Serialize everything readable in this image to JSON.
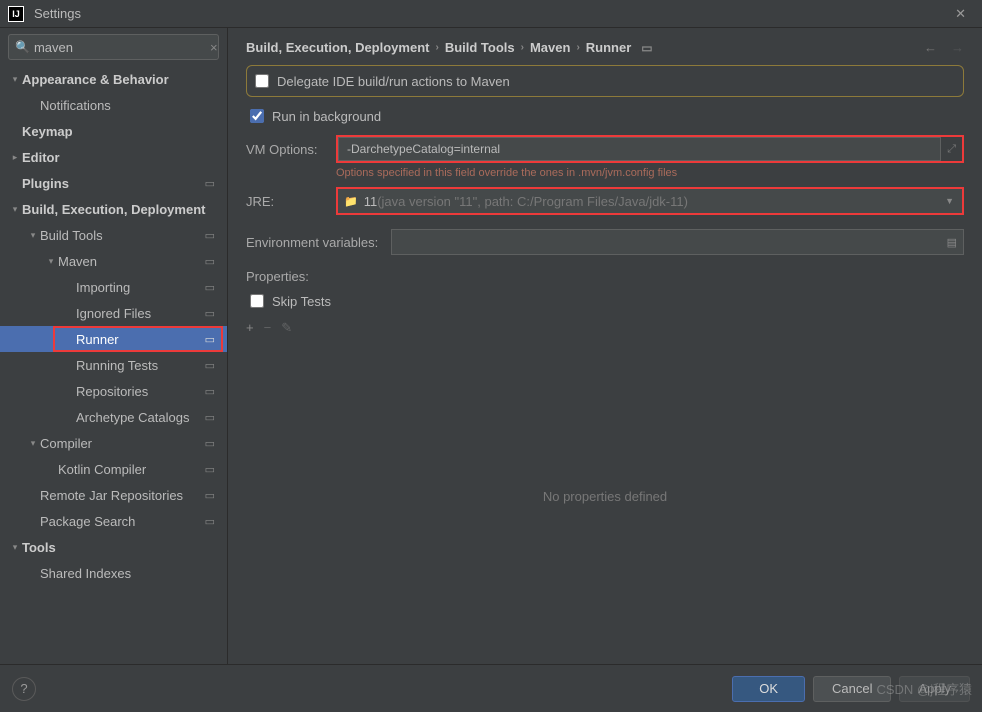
{
  "window": {
    "title": "Settings"
  },
  "search": {
    "value": "maven",
    "placeholder": ""
  },
  "tree": {
    "appearance": "Appearance & Behavior",
    "notifications": "Notifications",
    "keymap": "Keymap",
    "editor": "Editor",
    "plugins": "Plugins",
    "bed": "Build, Execution, Deployment",
    "build_tools": "Build Tools",
    "maven": "Maven",
    "importing": "Importing",
    "ignored": "Ignored Files",
    "runner": "Runner",
    "running_tests": "Running Tests",
    "repositories": "Repositories",
    "archetype": "Archetype Catalogs",
    "compiler": "Compiler",
    "kotlin": "Kotlin Compiler",
    "remote_jar": "Remote Jar Repositories",
    "package_search": "Package Search",
    "tools": "Tools",
    "shared_idx": "Shared Indexes"
  },
  "breadcrumb": {
    "a": "Build, Execution, Deployment",
    "b": "Build Tools",
    "c": "Maven",
    "d": "Runner"
  },
  "form": {
    "delegate_label": "Delegate IDE build/run actions to Maven",
    "run_bg_label": "Run in background",
    "vm_label": "VM Options:",
    "vm_value": "-DarchetypeCatalog=internal",
    "vm_hint": "Options specified in this field override the ones in .mvn/jvm.config files",
    "jre_label": "JRE:",
    "jre_value": "11",
    "jre_detail": " (java version \"11\", path: C:/Program Files/Java/jdk-11)",
    "env_label": "Environment variables:",
    "props_label": "Properties:",
    "skip_tests": "Skip Tests",
    "no_props": "No properties defined"
  },
  "footer": {
    "ok": "OK",
    "cancel": "Cancel",
    "apply": "Apply"
  },
  "watermark": "CSDN @j程序猿"
}
